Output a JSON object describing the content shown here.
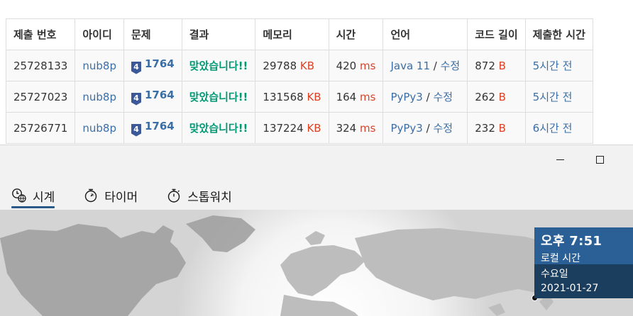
{
  "table": {
    "headers": [
      "제출 번호",
      "아이디",
      "문제",
      "결과",
      "메모리",
      "시간",
      "언어",
      "코드 길이",
      "제출한 시간"
    ],
    "rows": [
      {
        "id": "25728133",
        "user": "nub8p",
        "tier": "4",
        "problem": "1764",
        "result": "맞았습니다!!",
        "memory": "29788",
        "memory_unit": "KB",
        "time": "420",
        "time_unit": "ms",
        "lang": "Java 11",
        "sep": "/",
        "edit": "수정",
        "length": "872",
        "length_unit": "B",
        "submitted": "5시간 전"
      },
      {
        "id": "25727023",
        "user": "nub8p",
        "tier": "4",
        "problem": "1764",
        "result": "맞았습니다!!",
        "memory": "131568",
        "memory_unit": "KB",
        "time": "164",
        "time_unit": "ms",
        "lang": "PyPy3",
        "sep": "/",
        "edit": "수정",
        "length": "262",
        "length_unit": "B",
        "submitted": "5시간 전"
      },
      {
        "id": "25726771",
        "user": "nub8p",
        "tier": "4",
        "problem": "1764",
        "result": "맞았습니다!!",
        "memory": "137224",
        "memory_unit": "KB",
        "time": "324",
        "time_unit": "ms",
        "lang": "PyPy3",
        "sep": "/",
        "edit": "수정",
        "length": "232",
        "length_unit": "B",
        "submitted": "6시간 전"
      }
    ]
  },
  "clock": {
    "tabs": [
      {
        "label": "시계",
        "icon": "world-clock-icon"
      },
      {
        "label": "타이머",
        "icon": "timer-icon"
      },
      {
        "label": "스톱워치",
        "icon": "stopwatch-icon"
      }
    ],
    "active_tab": "시계",
    "card": {
      "time": "오후 7:51",
      "place": "로컬 시간",
      "day": "수요일",
      "date": "2021-01-27"
    }
  },
  "colors": {
    "accent": "#2b5a88",
    "ok": "#009874",
    "unit": "#dd4124",
    "link": "#3b6ea5",
    "card_top": "#2a6096",
    "card_bottom": "#1b3d5e"
  }
}
